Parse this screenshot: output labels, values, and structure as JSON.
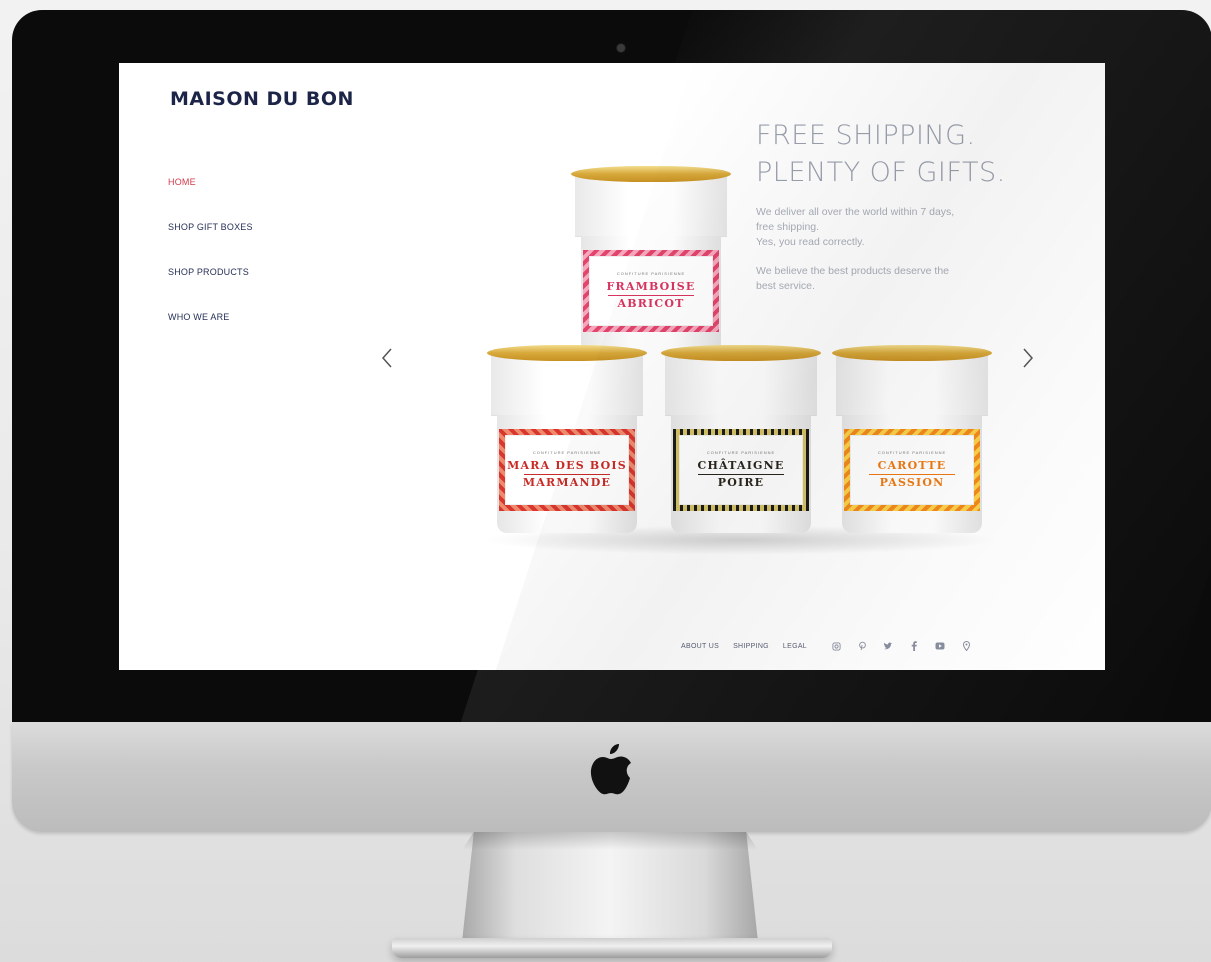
{
  "site": {
    "brand": "MAISON DU BON",
    "nav": [
      {
        "label": "HOME",
        "active": true
      },
      {
        "label": "SHOP GIFT BOXES",
        "active": false
      },
      {
        "label": "SHOP PRODUCTS",
        "active": false
      },
      {
        "label": "WHO WE ARE",
        "active": false
      }
    ],
    "hero": {
      "headline_line1": "FREE SHIPPING.",
      "headline_line2": "PLENTY OF GIFTS.",
      "paragraph1_line1": "We deliver all over the world within 7 days,",
      "paragraph1_line2": "free shipping.",
      "paragraph1_line3": "Yes, you read correctly.",
      "paragraph2_line1": "We believe the best products deserve the",
      "paragraph2_line2": "best service."
    },
    "products": [
      {
        "maker": "CONFITURE PARISIENNE",
        "line1": "FRAMBOISE",
        "line2": "ABRICOT"
      },
      {
        "maker": "CONFITURE PARISIENNE",
        "line1": "MARA DES BOIS",
        "line2": "MARMANDE"
      },
      {
        "maker": "CONFITURE PARISIENNE",
        "line1": "CHÂTAIGNE",
        "line2": "POIRE"
      },
      {
        "maker": "CONFITURE PARISIENNE",
        "line1": "CAROTTE",
        "line2": "PASSION"
      }
    ],
    "footer": {
      "links": [
        "ABOUT US",
        "SHIPPING",
        "LEGAL"
      ],
      "social_icons": [
        "instagram-icon",
        "pinterest-icon",
        "twitter-icon",
        "facebook-icon",
        "youtube-icon",
        "location-pin-icon"
      ]
    },
    "colors": {
      "brand_navy": "#1c2547",
      "active_nav": "#d23a4a",
      "headline_gray": "#9aa0ad"
    }
  }
}
